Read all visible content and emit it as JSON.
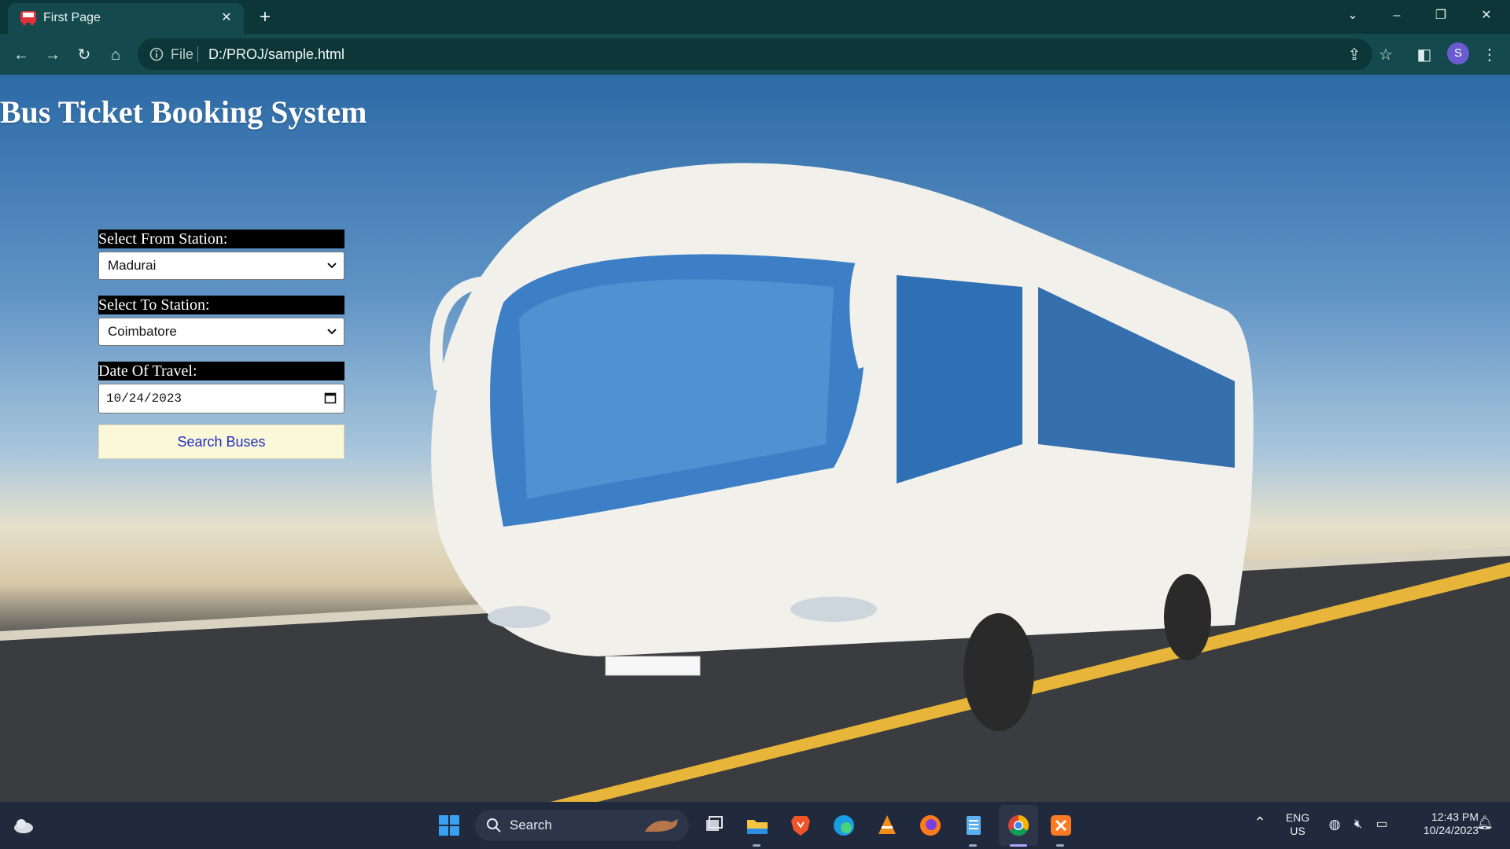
{
  "browser": {
    "tab_title": "First Page",
    "address_prefix": "File",
    "url": "D:/PROJ/sample.html",
    "profile_initial": "S"
  },
  "page": {
    "title": "Bus Ticket Booking System",
    "from_label": "Select From Station:",
    "from_value": "Madurai",
    "to_label": "Select To Station:",
    "to_value": "Coimbatore",
    "date_label": "Date Of Travel:",
    "date_value": "10/24/2023",
    "search_button": "Search Buses"
  },
  "taskbar": {
    "search_label": "Search",
    "lang_top": "ENG",
    "lang_bottom": "US",
    "time": "12:43 PM",
    "date": "10/24/2023"
  },
  "colors": {
    "chrome_dark": "#0c3638",
    "chrome_toolbar": "#144a4d",
    "label_bg": "#000000",
    "button_bg": "#fbf8d9",
    "button_text": "#1f2fbf",
    "taskbar_bg": "#202a3c"
  },
  "icons": [
    "back-icon",
    "forward-icon",
    "reload-icon",
    "home-icon",
    "info-icon",
    "share-icon",
    "star-icon",
    "side-panel-icon",
    "menu-icon",
    "windows-start-icon",
    "search-icon",
    "file-explorer-icon",
    "brave-icon",
    "edge-icon",
    "vlc-icon",
    "firefox-icon",
    "notepad-icon",
    "chrome-icon",
    "xampp-icon",
    "weather-icon"
  ]
}
